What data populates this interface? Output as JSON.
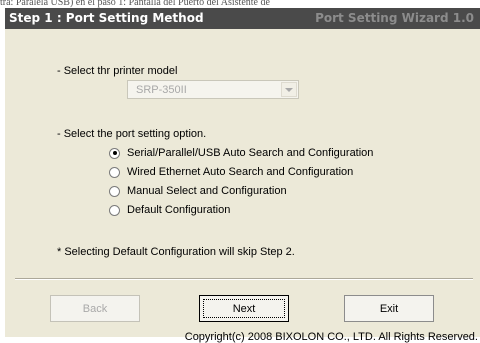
{
  "background_text": "tra: Paralela USB) en el paso 1: Pantalla del Puerto del Asistente de",
  "header": {
    "title": "Step 1 : Port Setting Method",
    "wizard_name": "Port Setting Wizard 1.0"
  },
  "printer_model": {
    "label": "- Select thr printer model",
    "selected": "SRP-350II",
    "disabled": true
  },
  "port_options": {
    "label": "- Select the port setting option.",
    "options": [
      {
        "label": "Serial/Parallel/USB Auto Search and Configuration",
        "checked": true
      },
      {
        "label": "Wired Ethernet  Auto Search and Configuration",
        "checked": false
      },
      {
        "label": "Manual Select and Configuration",
        "checked": false
      },
      {
        "label": "Default Configuration",
        "checked": false
      }
    ]
  },
  "note": "* Selecting Default Configuration will skip Step 2.",
  "buttons": {
    "back": "Back",
    "next": "Next",
    "exit": "Exit"
  },
  "copyright": "Copyright(c) 2008 BIXOLON CO., LTD. All Rights Reserved.",
  "colors": {
    "dialog_bg": "#ece9d8",
    "header_bg": "#4a4a4a",
    "header_title": "#ffffff",
    "header_wizard": "#8c8c8c"
  }
}
